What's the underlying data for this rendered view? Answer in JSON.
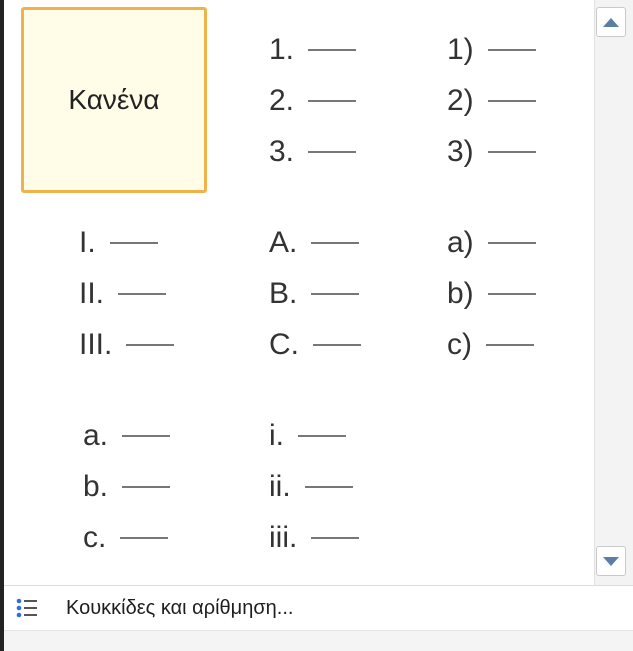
{
  "gallery": {
    "none_label": "Κανένα",
    "formats": [
      {
        "id": "numeric-period",
        "items": [
          "1.",
          "2.",
          "3."
        ]
      },
      {
        "id": "numeric-paren",
        "items": [
          "1)",
          "2)",
          "3)"
        ]
      },
      {
        "id": "roman-upper",
        "items": [
          "I.",
          "II.",
          "III."
        ]
      },
      {
        "id": "alpha-upper",
        "items": [
          "A.",
          "B.",
          "C."
        ]
      },
      {
        "id": "alpha-lower-paren",
        "items": [
          "a)",
          "b)",
          "c)"
        ]
      },
      {
        "id": "alpha-lower-period",
        "items": [
          "a.",
          "b.",
          "c."
        ]
      },
      {
        "id": "roman-lower",
        "items": [
          "i.",
          "ii.",
          "iii."
        ]
      }
    ]
  },
  "footer": {
    "icon": "list-bullets-icon",
    "label": "Κουκκίδες και αρίθμηση..."
  },
  "colors": {
    "selection_border": "#f0b24c",
    "selection_fill": "#fffce8",
    "scroll_arrow": "#5a7ea6"
  }
}
